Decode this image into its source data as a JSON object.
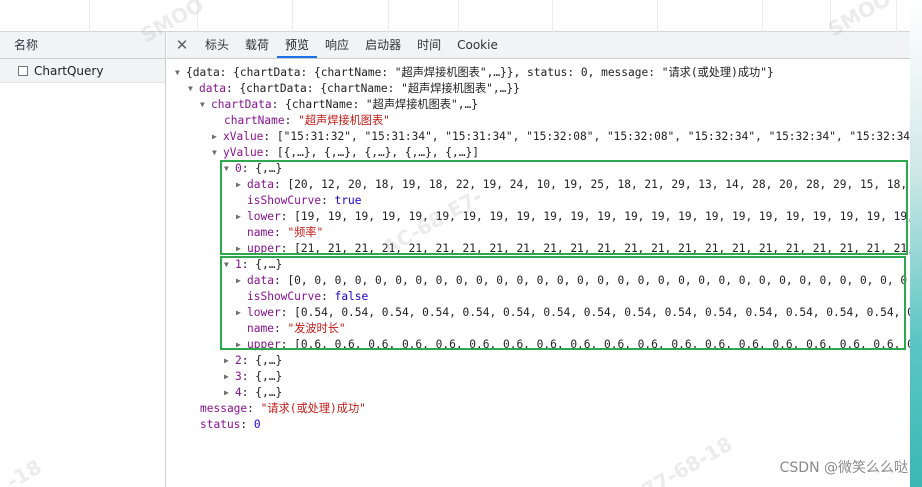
{
  "left_panel": {
    "header": "名称",
    "requests": [
      {
        "name": "ChartQuery"
      }
    ]
  },
  "tabs": [
    {
      "label": "标头",
      "selected": false
    },
    {
      "label": "载荷",
      "selected": false
    },
    {
      "label": "预览",
      "selected": true
    },
    {
      "label": "响应",
      "selected": false
    },
    {
      "label": "启动器",
      "selected": false
    },
    {
      "label": "时间",
      "selected": false
    },
    {
      "label": "Cookie",
      "selected": false
    }
  ],
  "close_icon": "close-icon",
  "preview": {
    "root_summary": "{data: {chartData: {chartName: \"超声焊接机图表\",…}}, status: 0, message: \"请求(或处理)成功\"}",
    "data_summary": "{chartData: {chartName: \"超声焊接机图表\",…}}",
    "chartdata_summary": "{chartName: \"超声焊接机图表\",…}",
    "chart_name": "\"超声焊接机图表\"",
    "xvalue": "[\"15:31:32\", \"15:31:34\", \"15:31:34\", \"15:32:08\", \"15:32:08\", \"15:32:34\", \"15:32:34\", \"15:32:34\",",
    "yvalue_summary": "[{,…}, {,…}, {,…}, {,…}, {,…}]",
    "item_summary": "{,…}",
    "items": [
      {
        "index": "0",
        "data": "[20, 12, 20, 18, 19, 18, 22, 19, 24, 10, 19, 25, 18, 21, 29, 13, 14, 28, 20, 28, 29, 15, 18, 2",
        "isShowCurve": "true",
        "lower": "[19, 19, 19, 19, 19, 19, 19, 19, 19, 19, 19, 19, 19, 19, 19, 19, 19, 19, 19, 19, 19, 19, 19,",
        "name": "\"频率\"",
        "upper": "[21, 21, 21, 21, 21, 21, 21, 21, 21, 21, 21, 21, 21, 21, 21, 21, 21, 21, 21, 21, 21, 21, 21,"
      },
      {
        "index": "1",
        "data": "[0, 0, 0, 0, 0, 0, 0, 0, 0, 0, 0, 0, 0, 0, 0, 0, 0, 0, 0, 0, 0, 0, 0, 0, 0, 0, 0, 0, 0, 0, 0",
        "isShowCurve": "false",
        "lower": "[0.54, 0.54, 0.54, 0.54, 0.54, 0.54, 0.54, 0.54, 0.54, 0.54, 0.54, 0.54, 0.54, 0.54, 0.54, 0.5",
        "name": "\"发波时长\"",
        "upper": "[0.6, 0.6, 0.6, 0.6, 0.6, 0.6, 0.6, 0.6, 0.6, 0.6, 0.6, 0.6, 0.6, 0.6, 0.6, 0.6, 0.6, 0.6, 0"
      }
    ],
    "collapsed_items": [
      "2",
      "3",
      "4"
    ],
    "message": "\"请求(或处理)成功\"",
    "status": "0"
  },
  "keys": {
    "data": "data",
    "chartData": "chartData",
    "chartName": "chartName",
    "xValue": "xValue",
    "yValue": "yValue",
    "isShowCurve": "isShowCurve",
    "lower": "lower",
    "name": "name",
    "upper": "upper",
    "message": "message",
    "status": "status"
  },
  "watermark": {
    "text_1": "SMOO",
    "text_2": "AC-68-E7-",
    "text_3": "-18",
    "text_4": "77-68-18"
  },
  "footer_mark": "CSDN @微笑么么哒",
  "colors": {
    "highlight_box": "#2ea84f",
    "tab_selected_underline": "#1a73e8",
    "json_key": "#881391",
    "json_string": "#c41a16",
    "json_number": "#1c00cf"
  }
}
